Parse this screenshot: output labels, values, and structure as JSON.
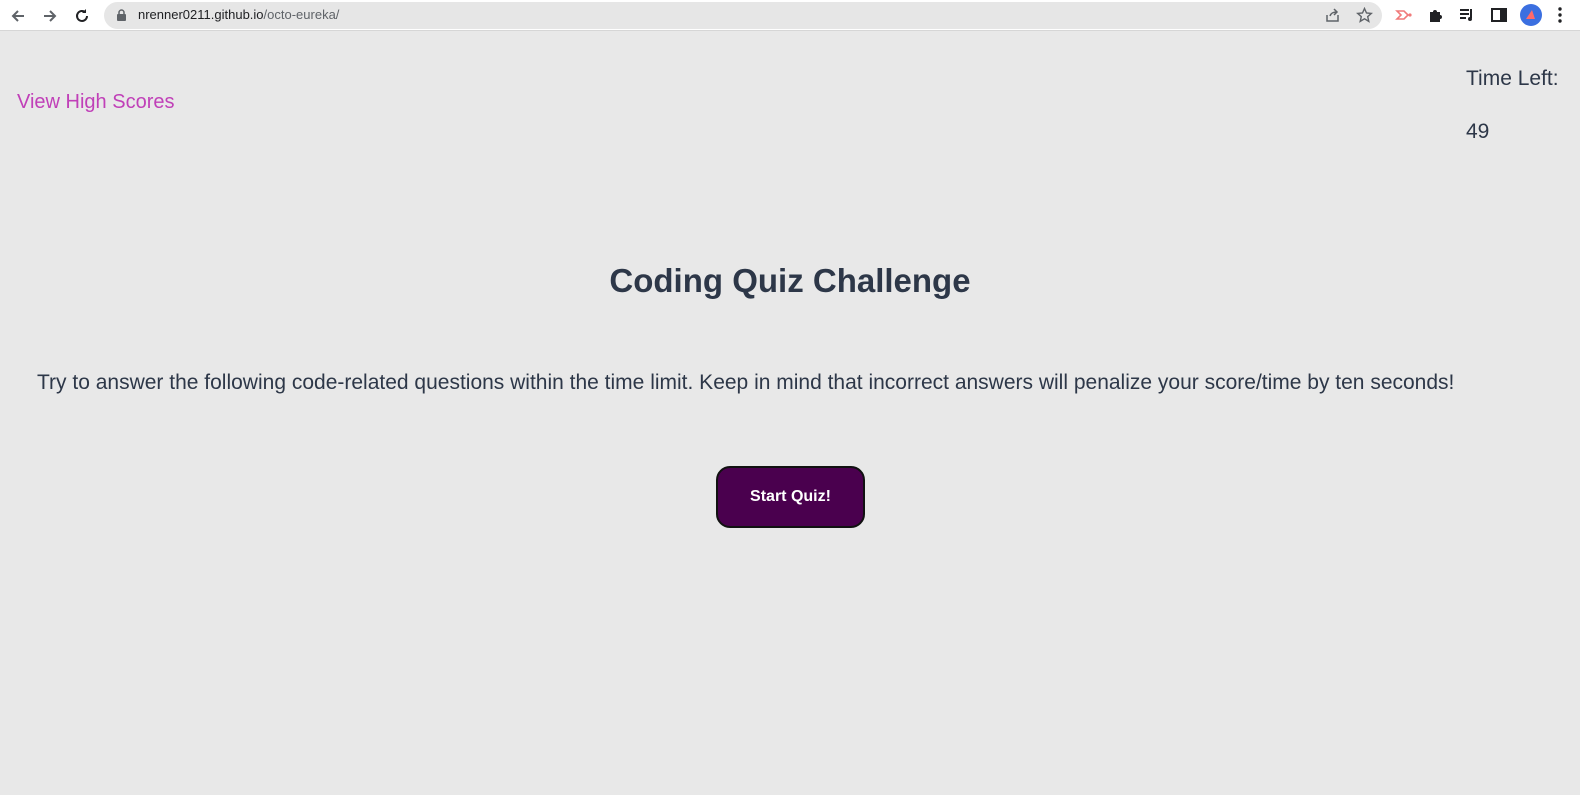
{
  "browser": {
    "url_host": "nrenner0211.github.io",
    "url_path": "/octo-eureka/",
    "icons": [
      "back-arrow-icon",
      "forward-arrow-icon",
      "reload-icon",
      "lock-icon",
      "share-icon",
      "star-icon",
      "extension-redirect-icon",
      "puzzle-icon",
      "media-icon",
      "side-panel-icon",
      "profile-avatar",
      "more-vert-icon"
    ]
  },
  "header": {
    "high_scores_label": "View High Scores",
    "timer_label": "Time Left:",
    "timer_value": "49"
  },
  "main": {
    "title": "Coding Quiz Challenge",
    "intro": "Try to answer the following code-related questions within the time limit. Keep in mind that incorrect answers will penalize your score/time by ten seconds!",
    "start_label": "Start Quiz!"
  },
  "colors": {
    "background": "#e8e8e8",
    "link": "#c040b8",
    "text": "#2d3748",
    "button": "#4a004e"
  }
}
